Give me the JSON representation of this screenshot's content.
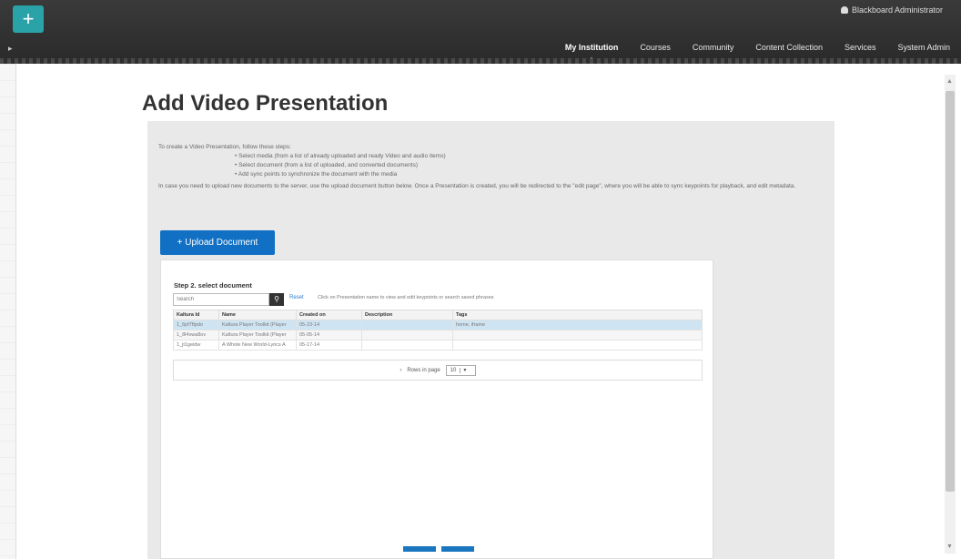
{
  "topbar": {
    "user_name": "Blackboard Administrator",
    "nav": [
      "My Institution",
      "Courses",
      "Community",
      "Content Collection",
      "Services",
      "System Admin"
    ],
    "active_nav": "My Institution"
  },
  "page": {
    "title": "Add Video Presentation"
  },
  "intro": {
    "lead": "To create a Video Presentation, follow these steps:",
    "steps": [
      "Select media (from a list of already uploaded and ready Video and audio items)",
      "Select document (from a list of uploaded, and converted documents)",
      "Add sync points to synchronize the document with the media"
    ],
    "note": "In case you need to upload new documents to the server, use the upload document button below. Once a Presentation is created, you will be redirected to the \"edit page\", where you will be able to sync keypoints for playback, and edit metadata."
  },
  "upload_button": "+ Upload Document",
  "step": {
    "title": "Step 2. select document",
    "search_placeholder": "Search",
    "reset_label": "Reset",
    "hint": "Click on Presentation name to view and edit keypoints or search saved phrases",
    "columns": [
      "Kaltura Id",
      "Name",
      "Created on",
      "Description",
      "Tags"
    ],
    "rows": [
      [
        "1_6pf7ftpdo",
        "Kaltura Player Toolkit (Player",
        "05-23-14",
        "",
        "home, iframe"
      ],
      [
        "1_8l4xwa8ov",
        "Kaltura Player Toolkit (Player",
        "05-05-14",
        "",
        ""
      ],
      [
        "1_jt1geidw",
        "A Whole New World-Lyrics A",
        "05-17-14",
        "",
        ""
      ]
    ],
    "rows_per_page_label": "Rows in page",
    "rows_per_page_value": "10"
  }
}
